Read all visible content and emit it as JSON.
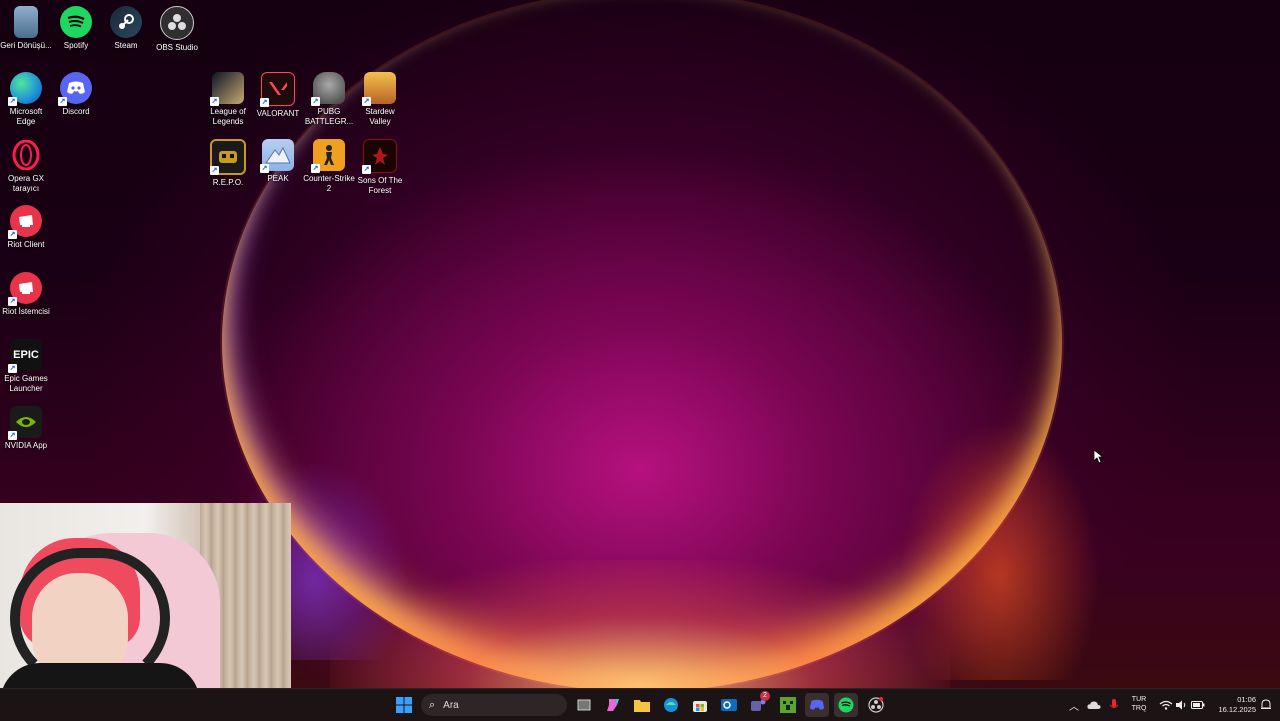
{
  "desktop": {
    "icons": [
      {
        "label": "Geri Dönüşü...",
        "icon": "recycle-bin-icon",
        "color": "#4b6e8f"
      },
      {
        "label": "Spotify",
        "icon": "spotify-icon",
        "color": "#1ed760"
      },
      {
        "label": "Steam",
        "icon": "steam-icon",
        "color": "#1b2838"
      },
      {
        "label": "OBS Studio",
        "icon": "obs-icon",
        "color": "#302e31"
      },
      {
        "label": "Microsoft Edge",
        "icon": "edge-icon",
        "color": "#1d8fd8"
      },
      {
        "label": "Discord",
        "icon": "discord-icon",
        "color": "#5865f2"
      },
      {
        "label": "Opera GX tarayıcı",
        "icon": "opera-gx-icon",
        "color": "#fa1e4e"
      },
      {
        "label": "Riot Client",
        "icon": "riot-client-icon",
        "color": "#e8334a"
      },
      {
        "label": "Riot İstemcisi",
        "icon": "riot-istemcisi-icon",
        "color": "#e8334a"
      },
      {
        "label": "Epic Games Launcher",
        "icon": "epic-games-icon",
        "color": "#111111"
      },
      {
        "label": "NVIDIA App",
        "icon": "nvidia-icon",
        "color": "#76b900"
      },
      {
        "label": "League of Legends",
        "icon": "league-of-legends-icon",
        "color": "#c8aa6e"
      },
      {
        "label": "VALORANT",
        "icon": "valorant-icon",
        "color": "#ff4655"
      },
      {
        "label": "PUBG BATTLEGR...",
        "icon": "pubg-icon",
        "color": "#3c3c3c"
      },
      {
        "label": "Stardew Valley",
        "icon": "stardew-valley-icon",
        "color": "#e8a33c"
      },
      {
        "label": "R.E.P.O.",
        "icon": "repo-icon",
        "color": "#c89b1e"
      },
      {
        "label": "PEAK",
        "icon": "peak-icon",
        "color": "#8ab4e8"
      },
      {
        "label": "Counter-Strike 2",
        "icon": "counter-strike-icon",
        "color": "#f0a020"
      },
      {
        "label": "Sons Of The Forest",
        "icon": "sons-of-the-forest-icon",
        "color": "#8a1010"
      }
    ]
  },
  "taskbar": {
    "search_placeholder": "Ara",
    "pinned": [
      {
        "icon": "start-icon",
        "color": "#3aa0ff"
      },
      {
        "icon": "task-view-icon",
        "color": "#cccccc"
      },
      {
        "icon": "copilot-icon",
        "color": "#e86ad8"
      },
      {
        "icon": "file-explorer-icon",
        "color": "#f5c542"
      },
      {
        "icon": "edge-icon",
        "color": "#1d8fd8"
      },
      {
        "icon": "store-icon",
        "color": "#3a8ee6"
      },
      {
        "icon": "outlook-icon",
        "color": "#0f6cbd"
      },
      {
        "icon": "teams-icon",
        "color": "#6264a7"
      },
      {
        "icon": "minecraft-icon",
        "color": "#5aa52c"
      },
      {
        "icon": "discord-icon",
        "color": "#5865f2"
      },
      {
        "icon": "spotify-icon",
        "color": "#1ed760"
      },
      {
        "icon": "obs-icon",
        "color": "#cccccc"
      }
    ],
    "teams_badge": "2",
    "tray": {
      "language_line1": "TUR",
      "language_line2": "TRQ",
      "time": "01:06",
      "date": "16.12.2025"
    }
  }
}
